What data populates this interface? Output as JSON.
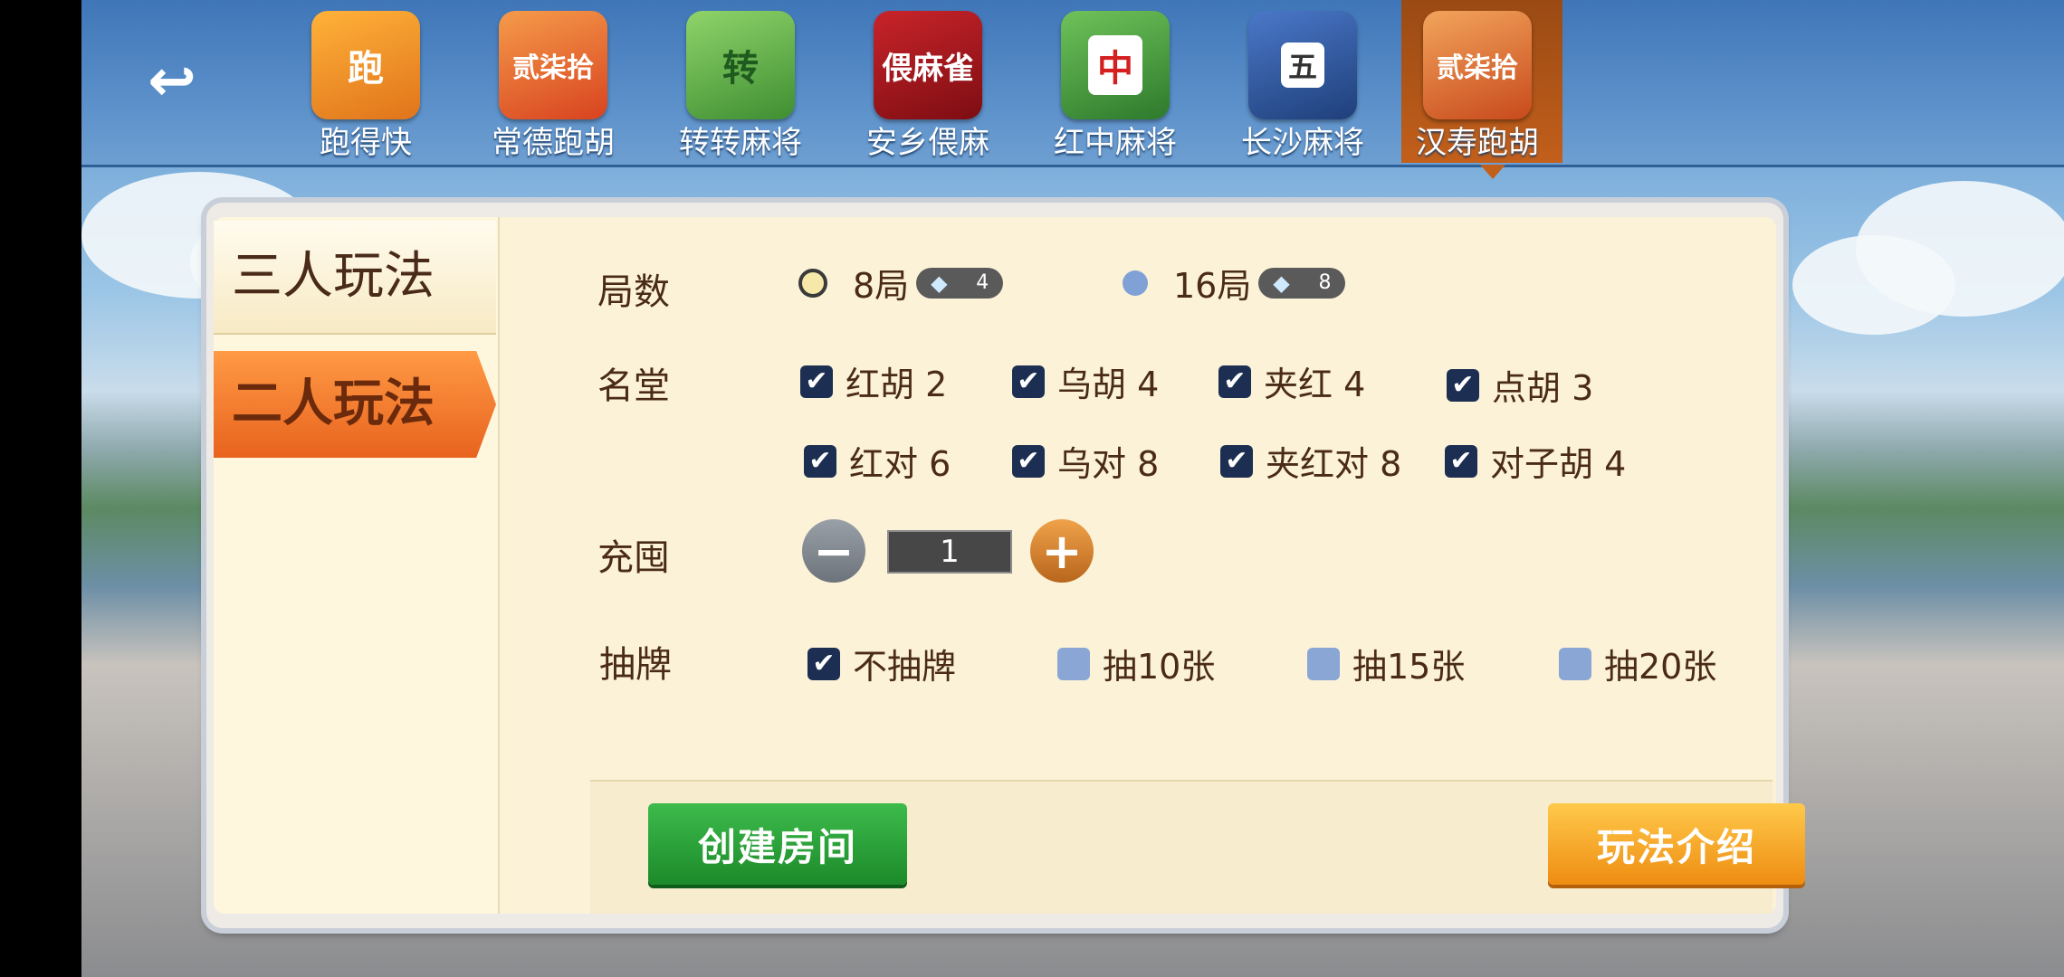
{
  "header": {
    "back_icon": "back-arrow-icon",
    "games": [
      {
        "label": "跑得快",
        "icon": "跑",
        "color": "#f08b1f"
      },
      {
        "label": "常德跑胡",
        "icon": "贰柒拾",
        "color": "#e8602a"
      },
      {
        "label": "转转麻将",
        "icon": "转",
        "color": "#5aa84a"
      },
      {
        "label": "安乡偎麻",
        "icon": "偎麻雀",
        "color": "#a8181e"
      },
      {
        "label": "红中麻将",
        "icon": "中",
        "color": "#3e8f3a"
      },
      {
        "label": "长沙麻将",
        "icon": "五",
        "color": "#2a4d8c"
      },
      {
        "label": "汉寿跑胡",
        "icon": "贰柒拾",
        "color": "#e06a2a"
      }
    ],
    "active_index": 6
  },
  "sidebar": {
    "tab_three": "三人玩法",
    "tab_two": "二人玩法",
    "active": "二人玩法"
  },
  "rounds": {
    "label": "局数",
    "options": [
      {
        "text": "8局",
        "cost": "4",
        "selected": true
      },
      {
        "text": "16局",
        "cost": "8",
        "selected": false
      }
    ]
  },
  "mingtang": {
    "label": "名堂",
    "options": [
      {
        "text": "红胡 2",
        "checked": true
      },
      {
        "text": "乌胡 4",
        "checked": true
      },
      {
        "text": "夹红 4",
        "checked": true
      },
      {
        "text": "点胡 3",
        "checked": true
      },
      {
        "text": "红对 6",
        "checked": true
      },
      {
        "text": "乌对 8",
        "checked": true
      },
      {
        "text": "夹红对 8",
        "checked": true
      },
      {
        "text": "对子胡 4",
        "checked": true
      }
    ]
  },
  "chongdun": {
    "label": "充囤",
    "value": "1"
  },
  "draw": {
    "label": "抽牌",
    "options": [
      {
        "text": "不抽牌",
        "checked": true
      },
      {
        "text": "抽10张",
        "checked": false
      },
      {
        "text": "抽15张",
        "checked": false
      },
      {
        "text": "抽20张",
        "checked": false
      }
    ]
  },
  "buttons": {
    "create": "创建房间",
    "rules": "玩法介绍"
  }
}
